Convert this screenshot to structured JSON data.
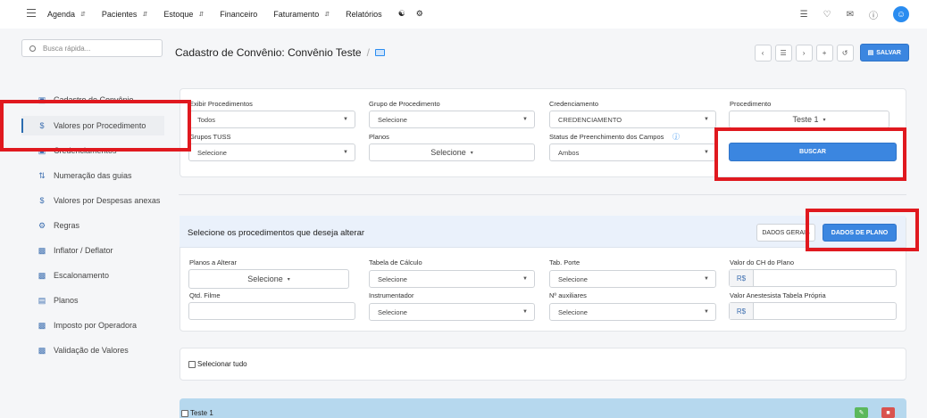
{
  "nav": {
    "items": [
      {
        "label": "Agenda",
        "has_chevron": true
      },
      {
        "label": "Pacientes",
        "has_chevron": true
      },
      {
        "label": "Estoque",
        "has_chevron": true
      },
      {
        "label": "Financeiro",
        "has_chevron": false
      },
      {
        "label": "Faturamento",
        "has_chevron": true
      },
      {
        "label": "Relatórios",
        "has_chevron": false
      }
    ],
    "avatar_letter": "☺"
  },
  "sidebar": {
    "search_placeholder": "Busca rápida...",
    "items": [
      {
        "label": "Cadastro de Convênio",
        "icon": "card-icon"
      },
      {
        "label": "Valores por Procedimento",
        "icon": "dollar-icon"
      },
      {
        "label": "Credenciamentos",
        "icon": "card-icon"
      },
      {
        "label": "Numeração das guias",
        "icon": "sort-numeric-icon"
      },
      {
        "label": "Valores por Despesas anexas",
        "icon": "dollar-icon"
      },
      {
        "label": "Regras",
        "icon": "gears-icon"
      },
      {
        "label": "Inflator / Deflator",
        "icon": "money-icon"
      },
      {
        "label": "Escalonamento",
        "icon": "money-icon"
      },
      {
        "label": "Planos",
        "icon": "list-icon"
      },
      {
        "label": "Imposto por Operadora",
        "icon": "money-icon"
      },
      {
        "label": "Validação de Valores",
        "icon": "money-icon"
      }
    ]
  },
  "page": {
    "title": "Cadastro de Convênio: Convênio Teste",
    "separator": "/",
    "save_label": "SALVAR"
  },
  "filters": {
    "exibir_label": "Exibir Procedimentos",
    "exibir_value": "Todos",
    "grupo_label": "Grupo de Procedimento",
    "grupo_value": "Selecione",
    "cred_label": "Credenciamento",
    "cred_value": "CREDENCIAMENTO",
    "proc_label": "Procedimento",
    "proc_value": "Teste 1",
    "tuss_label": "Grupos TUSS",
    "tuss_value": "Selecione",
    "planos_label": "Planos",
    "planos_value": "Selecione",
    "status_label": "Status de Preenchimento dos Campos",
    "status_value": "Ambos",
    "buscar_label": "BUSCAR"
  },
  "alter": {
    "title": "Selecione os procedimentos que deseja alterar",
    "tab_gerais": "DADOS GERAIS",
    "tab_plano": "DADOS DE PLANO",
    "planos_label": "Planos a Alterar",
    "planos_value": "Selecione",
    "tabela_label": "Tabela de Cálculo",
    "tabela_value": "Selecione",
    "porte_label": "Tab. Porte",
    "porte_value": "Selecione",
    "ch_label": "Valor do CH do Plano",
    "currency": "R$",
    "filme_label": "Qtd. Filme",
    "instr_label": "Instrumentador",
    "instr_value": "Selecione",
    "aux_label": "Nº auxiliares",
    "aux_value": "Selecione",
    "anest_label": "Valor Anestesista Tabela Própria"
  },
  "list": {
    "select_all": "Selecionar tudo",
    "row_label": "Teste 1"
  },
  "colors": {
    "accent": "#3b86e0",
    "highlight": "#e0191f",
    "row_bg": "#b6d8ee",
    "edit_green": "#5cb85c",
    "delete_red": "#d9534f"
  }
}
